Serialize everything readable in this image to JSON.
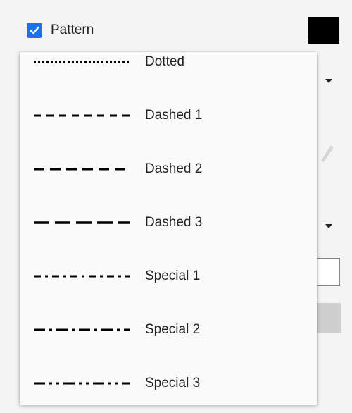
{
  "header": {
    "checkbox_checked": true,
    "label": "Pattern",
    "swatch_color": "#000000"
  },
  "menu": {
    "items": [
      {
        "label": "Dotted",
        "pattern": "dotted"
      },
      {
        "label": "Dashed 1",
        "pattern": "dashed-1"
      },
      {
        "label": "Dashed 2",
        "pattern": "dashed-2"
      },
      {
        "label": "Dashed 3",
        "pattern": "dashed-3"
      },
      {
        "label": "Special 1",
        "pattern": "special-1"
      },
      {
        "label": "Special 2",
        "pattern": "special-2"
      },
      {
        "label": "Special 3",
        "pattern": "special-3"
      }
    ]
  },
  "colors": {
    "accent": "#1a73e8",
    "line": "#000000"
  }
}
